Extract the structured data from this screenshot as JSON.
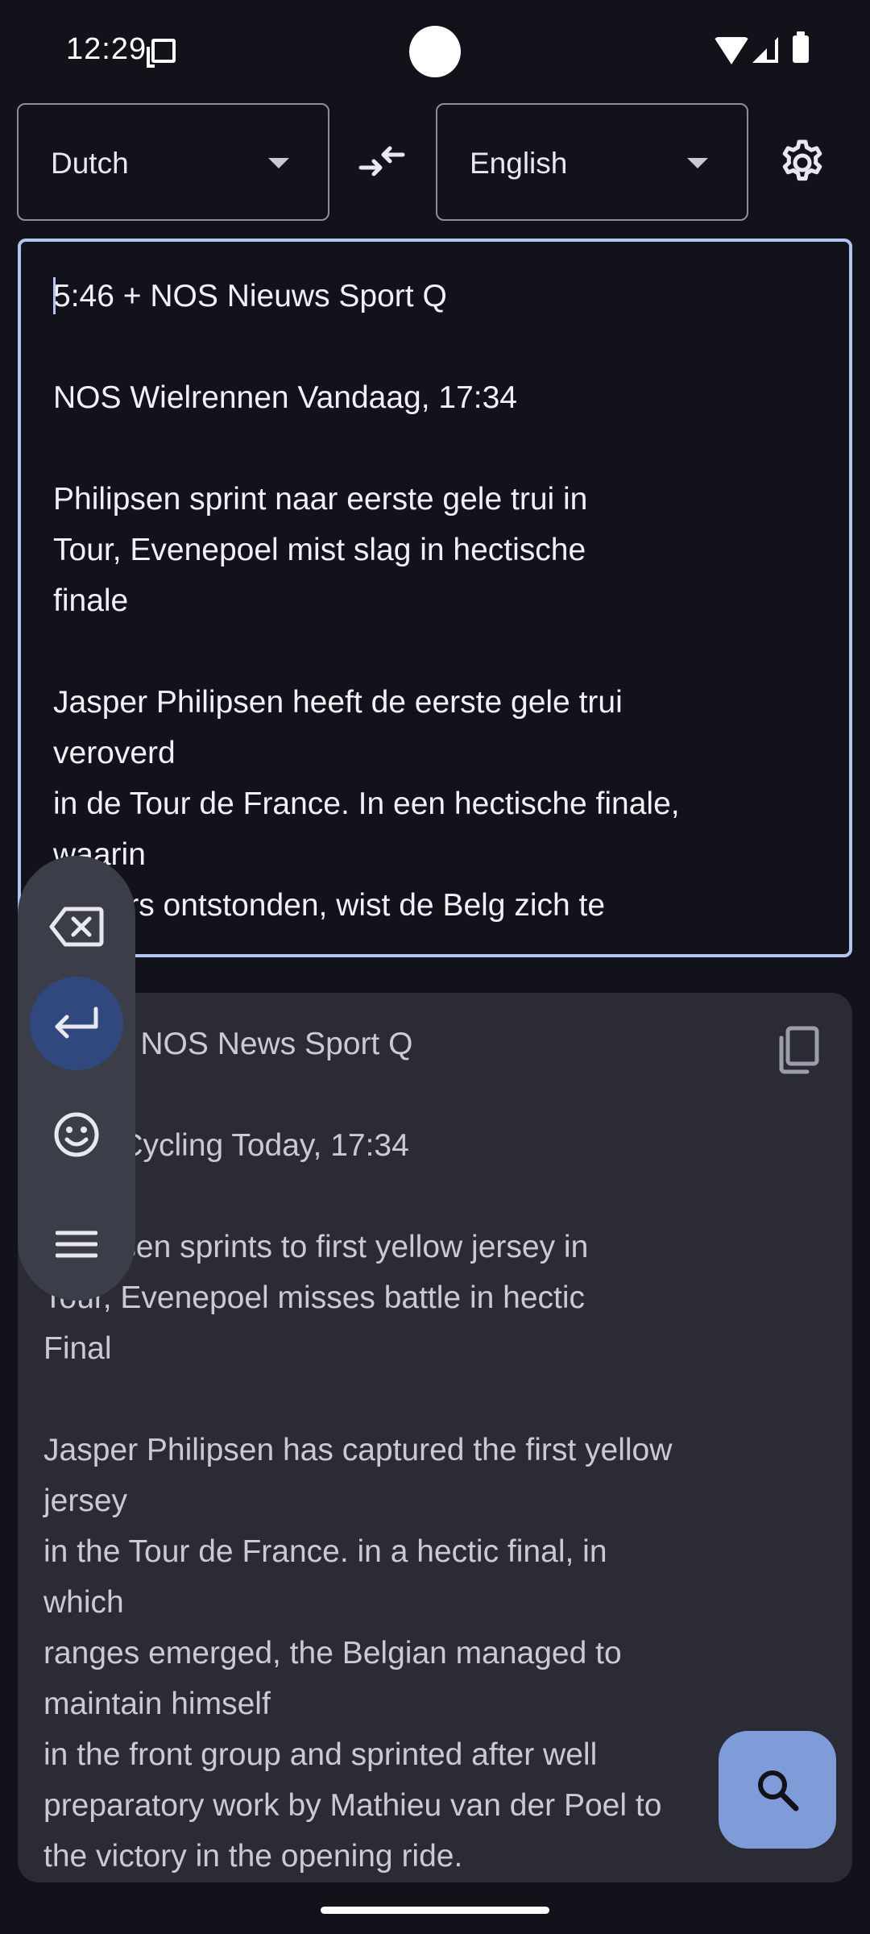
{
  "status_bar": {
    "time": "12:29",
    "icons": [
      "sim-card-icon",
      "wifi-icon",
      "signal-icon",
      "battery-icon"
    ]
  },
  "language_bar": {
    "source_language": "Dutch",
    "target_language": "English",
    "swap_icon": "swap-arrows-icon",
    "settings_icon": "gear-icon"
  },
  "input": {
    "text": "5:46 + NOS Nieuws Sport Q\n\nNOS Wielrennen Vandaag, 17:34\n\nPhilipsen sprint naar eerste gele trui in\nTour, Evenepoel mist slag in hectische\nfinale\n\nJasper Philipsen heeft de eerste gele trui\nveroverd\nin de Tour de France. In een hectische finale,\nwaarin\nvalpers ontstonden, wist de Belg zich te"
  },
  "output": {
    "text": "5:46 + NOS News Sport Q\n\nNOS Cycling Today, 17:34\n\nPhilipsen sprints to first yellow jersey in\nTour, Evenepoel misses battle in hectic\nFinal\n\nJasper Philipsen has captured the first yellow\njersey\nin the Tour de France. in a hectic final, in\nwhich\nranges emerged, the Belgian managed to\nmaintain himself\nin the front group and sprinted after well\npreparatory work by Mathieu van der Poel to\nthe victory in the opening ride.",
    "copy_icon": "copy-icon"
  },
  "floating_toolbar": {
    "buttons": [
      "backspace-icon",
      "enter-icon",
      "emoji-icon",
      "menu-icon"
    ]
  },
  "fab": {
    "icon": "search-icon"
  },
  "colors": {
    "background": "#12131a",
    "input_border": "#b4c4f0",
    "output_background": "#2a2b35",
    "fab": "#7f9bd8",
    "enter_button": "#31487e"
  }
}
